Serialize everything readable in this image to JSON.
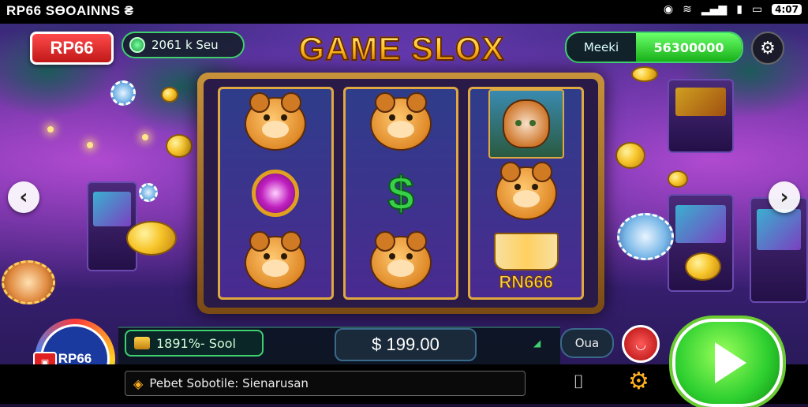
{
  "status_bar": {
    "title": "RP66 SӨOAINNS ₴",
    "icons": [
      "app-icon",
      "wifi-icon",
      "signal-icon",
      "battery-icon"
    ],
    "battery": "4:07"
  },
  "header": {
    "logo": "RP66",
    "balance": "2061 k  Seu",
    "title": "GAME SLOX",
    "mode_label": "Meeki",
    "mode_value": "56300000"
  },
  "reels": {
    "book_label": "RN666"
  },
  "bottom": {
    "win_text": "1891%- Sool",
    "total": "$ 199.00",
    "bet_label": "Oua",
    "avatar_label": "RP66",
    "ticker": "Pebet Sobotile: Sienarusan"
  },
  "colors": {
    "accent_green": "#3fd070",
    "title_gold": "#ffc020",
    "logo_red": "#e02020"
  }
}
